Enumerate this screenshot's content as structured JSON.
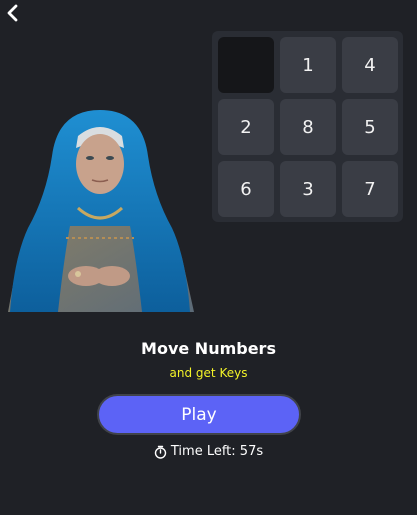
{
  "header": {
    "back_icon": "chevron-left-icon"
  },
  "puzzle": {
    "tiles": [
      "",
      "1",
      "4",
      "2",
      "8",
      "5",
      "6",
      "3",
      "7"
    ]
  },
  "info": {
    "title": "Move Numbers",
    "subtitle": "and get Keys",
    "play_label": "Play",
    "timer_icon": "stopwatch-icon",
    "timer_text": "Time Left: 57s"
  },
  "colors": {
    "background": "#1f2126",
    "board": "#2a2d34",
    "tile": "#3a3d45",
    "empty_tile": "#151619",
    "accent": "#5c63f6",
    "subtitle": "#f3f328"
  }
}
